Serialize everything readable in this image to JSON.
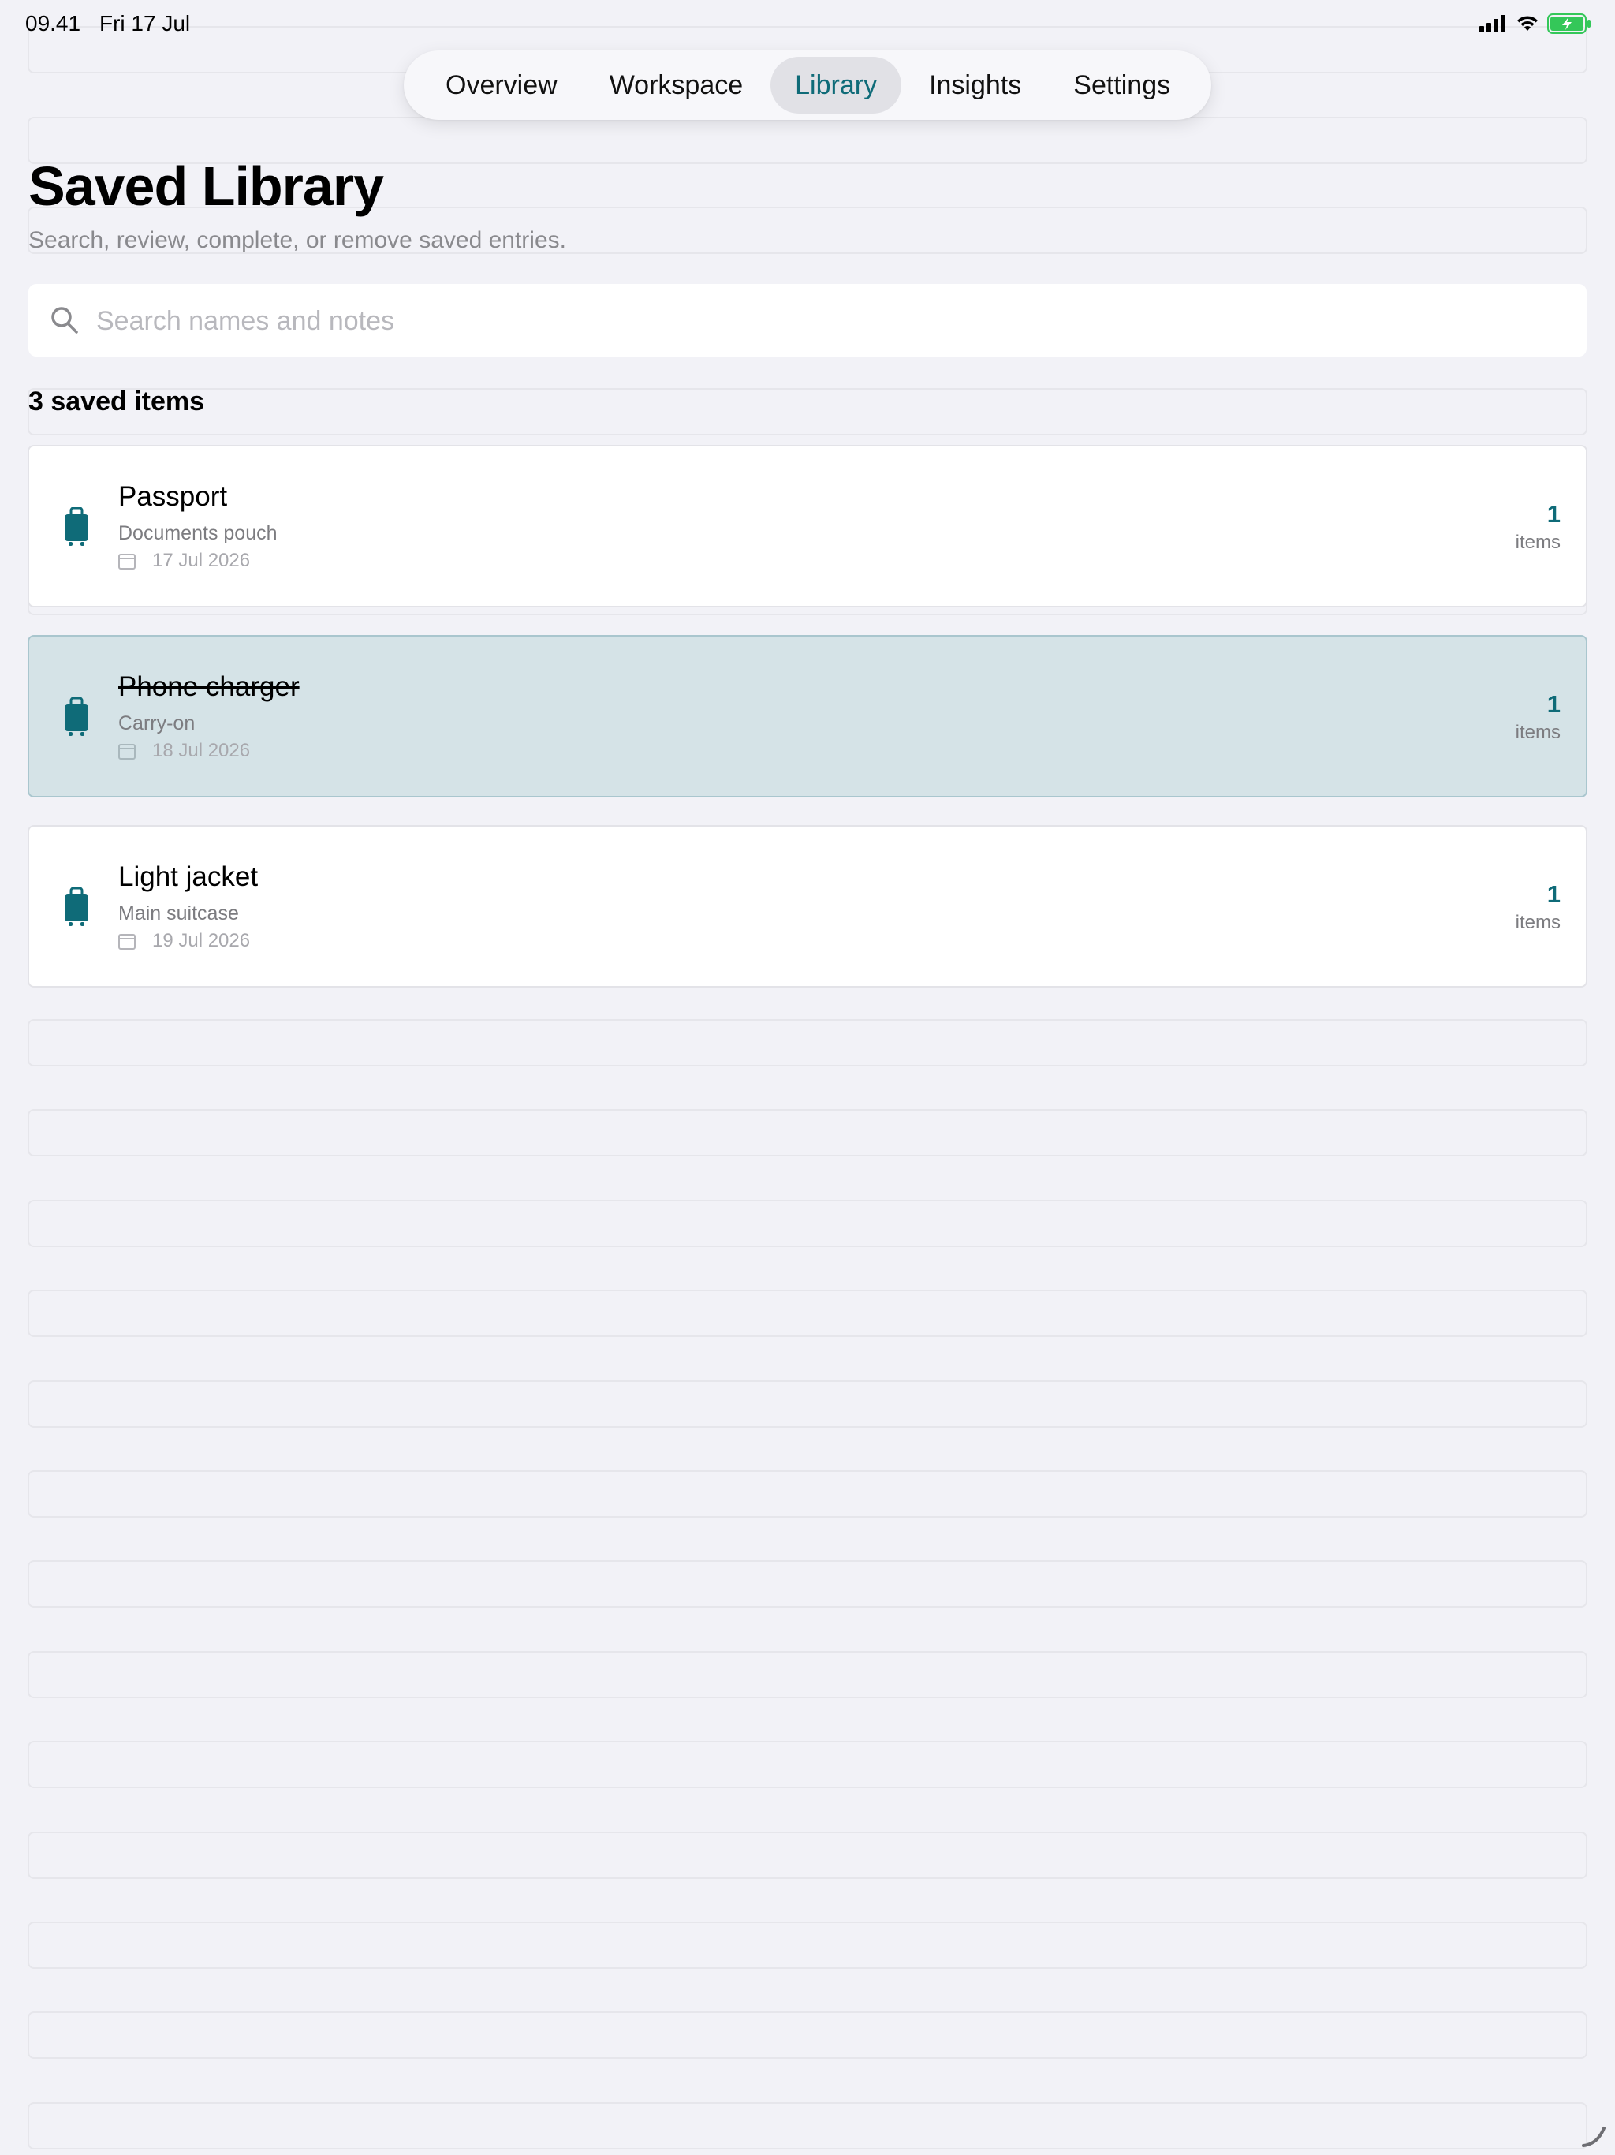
{
  "status_bar": {
    "time": "09.41",
    "date": "Fri 17 Jul",
    "icons": [
      "cellular-signal-icon",
      "wifi-icon",
      "battery-charging-icon"
    ]
  },
  "tabs": [
    {
      "label": "Overview",
      "active": false
    },
    {
      "label": "Workspace",
      "active": false
    },
    {
      "label": "Library",
      "active": true
    },
    {
      "label": "Insights",
      "active": false
    },
    {
      "label": "Settings",
      "active": false
    }
  ],
  "header": {
    "title": "Saved Library",
    "subtitle": "Search, review, complete, or remove saved entries."
  },
  "search": {
    "placeholder": "Search names and notes",
    "value": ""
  },
  "list": {
    "count_label": "3 saved items",
    "items": [
      {
        "title": "Passport",
        "location": "Documents pouch",
        "date": "17 Jul 2026",
        "count": "1",
        "unit": "items",
        "completed": false,
        "icon": "luggage-icon"
      },
      {
        "title": "Phone charger",
        "location": "Carry-on",
        "date": "18 Jul 2026",
        "count": "1",
        "unit": "items",
        "completed": true,
        "icon": "luggage-icon"
      },
      {
        "title": "Light jacket",
        "location": "Main suitcase",
        "date": "19 Jul 2026",
        "count": "1",
        "unit": "items",
        "completed": false,
        "icon": "luggage-icon"
      }
    ]
  },
  "colors": {
    "accent": "#0f6b78",
    "background": "#f2f2f7",
    "completed_row": "#d5e3e7"
  }
}
